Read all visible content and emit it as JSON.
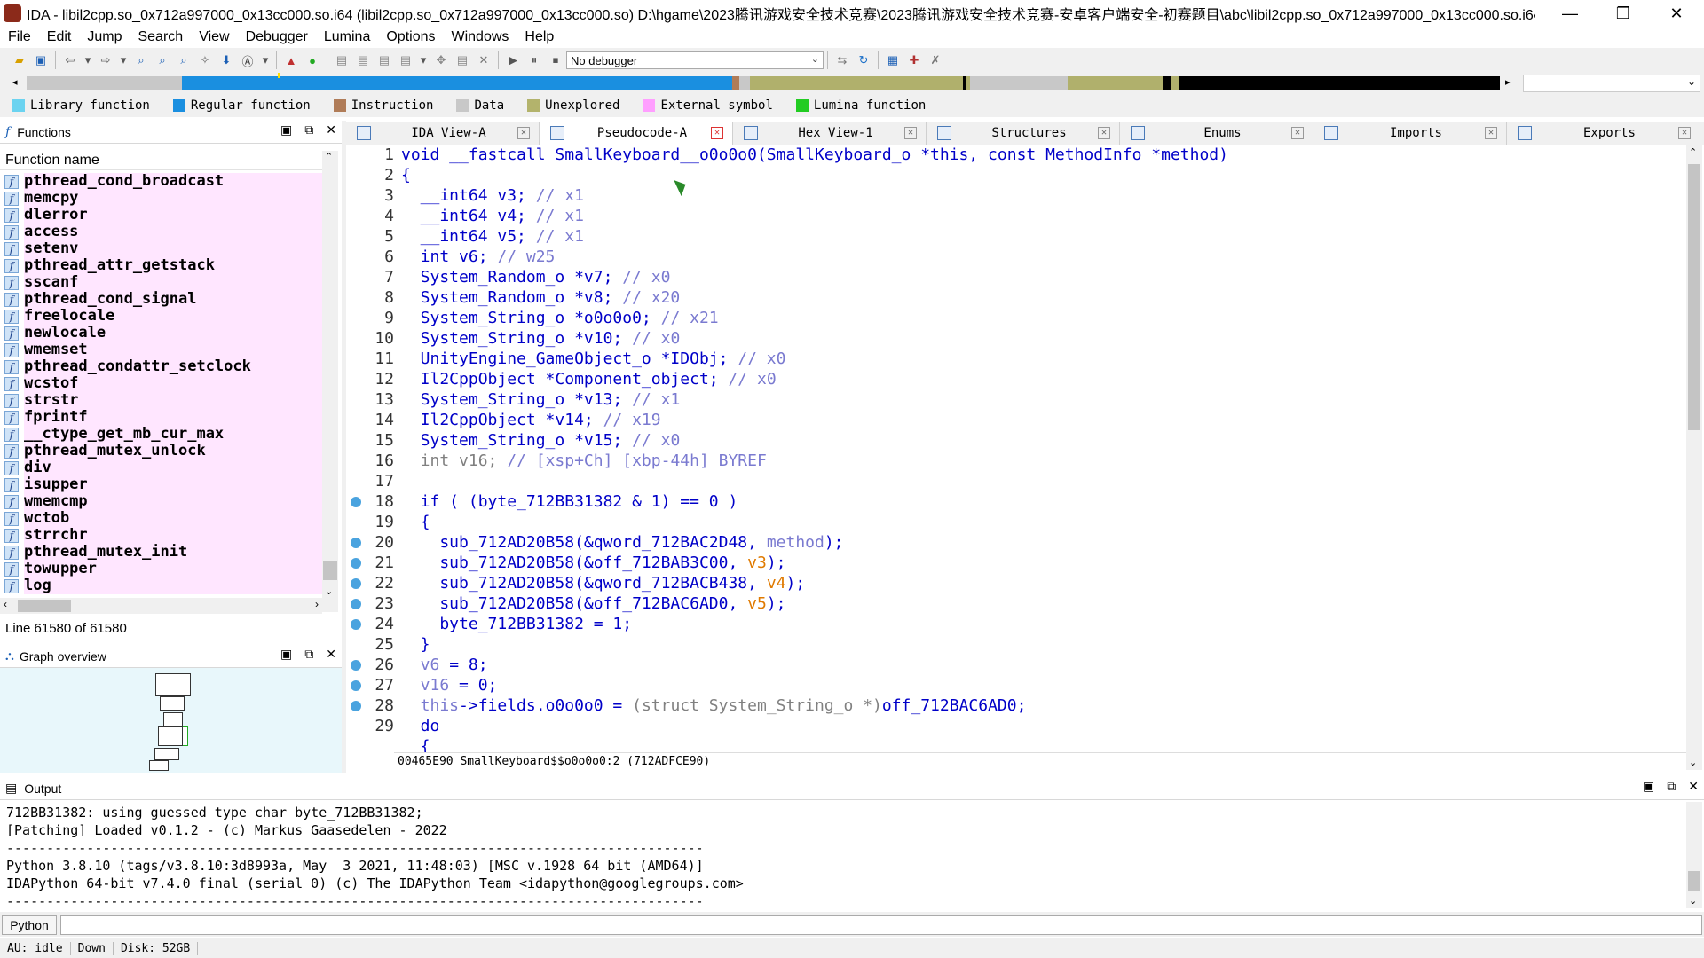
{
  "window": {
    "title": "IDA - libil2cpp.so_0x712a997000_0x13cc000.so.i64 (libil2cpp.so_0x712a997000_0x13cc000.so) D:\\hgame\\2023腾讯游戏安全技术竞赛\\2023腾讯游戏安全技术竞赛-安卓客户端安全-初赛题目\\abc\\libil2cpp.so_0x712a997000_0x13cc000.so.i64",
    "minimize": "—",
    "maximize": "❐",
    "close": "✕"
  },
  "menu": [
    "File",
    "Edit",
    "Jump",
    "Search",
    "View",
    "Debugger",
    "Lumina",
    "Options",
    "Windows",
    "Help"
  ],
  "toolbar": {
    "debugger_value": "No debugger"
  },
  "legend": [
    {
      "label": "Library function",
      "color": "#6bd3f0"
    },
    {
      "label": "Regular function",
      "color": "#1a8fe0"
    },
    {
      "label": "Instruction",
      "color": "#b07c58"
    },
    {
      "label": "Data",
      "color": "#c8c8c8"
    },
    {
      "label": "Unexplored",
      "color": "#b3b36c"
    },
    {
      "label": "External symbol",
      "color": "#ff9fff"
    },
    {
      "label": "Lumina function",
      "color": "#22cc22"
    }
  ],
  "functions_panel": {
    "title": "Functions",
    "column": "Function name",
    "items": [
      "pthread_cond_broadcast",
      "memcpy",
      "dlerror",
      "access",
      "setenv",
      "pthread_attr_getstack",
      "sscanf",
      "pthread_cond_signal",
      "freelocale",
      "newlocale",
      "wmemset",
      "pthread_condattr_setclock",
      "wcstof",
      "strstr",
      "fprintf",
      "__ctype_get_mb_cur_max",
      "pthread_mutex_unlock",
      "div",
      "isupper",
      "wmemcmp",
      "wctob",
      "strrchr",
      "pthread_mutex_init",
      "towupper",
      "log"
    ],
    "status": "Line 61580 of 61580"
  },
  "graph_panel": {
    "title": "Graph overview"
  },
  "tabs": [
    {
      "label": "IDA View-A",
      "active": false
    },
    {
      "label": "Pseudocode-A",
      "active": true
    },
    {
      "label": "Hex View-1",
      "active": false
    },
    {
      "label": "Structures",
      "active": false
    },
    {
      "label": "Enums",
      "active": false
    },
    {
      "label": "Imports",
      "active": false
    },
    {
      "label": "Exports",
      "active": false
    }
  ],
  "code": [
    {
      "n": "1",
      "bp": false,
      "parts": [
        [
          "t",
          "void __fastcall SmallKeyboard__o0o0o0(SmallKeyboard_o *this, const MethodInfo *method)"
        ]
      ]
    },
    {
      "n": "2",
      "bp": false,
      "parts": [
        [
          "t",
          "{"
        ]
      ]
    },
    {
      "n": "3",
      "bp": false,
      "parts": [
        [
          "t",
          "  __int64 v3; "
        ],
        [
          "m",
          "// x1"
        ]
      ]
    },
    {
      "n": "4",
      "bp": false,
      "parts": [
        [
          "t",
          "  __int64 v4; "
        ],
        [
          "m",
          "// x1"
        ]
      ]
    },
    {
      "n": "5",
      "bp": false,
      "parts": [
        [
          "t",
          "  __int64 v5; "
        ],
        [
          "m",
          "// x1"
        ]
      ]
    },
    {
      "n": "6",
      "bp": false,
      "parts": [
        [
          "t",
          "  int v6; "
        ],
        [
          "m",
          "// w25"
        ]
      ]
    },
    {
      "n": "7",
      "bp": false,
      "parts": [
        [
          "t",
          "  System_Random_o *v7; "
        ],
        [
          "m",
          "// x0"
        ]
      ]
    },
    {
      "n": "8",
      "bp": false,
      "parts": [
        [
          "t",
          "  System_Random_o *v8; "
        ],
        [
          "m",
          "// x20"
        ]
      ]
    },
    {
      "n": "9",
      "bp": false,
      "parts": [
        [
          "t",
          "  System_String_o *o0o0o0; "
        ],
        [
          "m",
          "// x21"
        ]
      ]
    },
    {
      "n": "10",
      "bp": false,
      "parts": [
        [
          "t",
          "  System_String_o *v10; "
        ],
        [
          "m",
          "// x0"
        ]
      ]
    },
    {
      "n": "11",
      "bp": false,
      "parts": [
        [
          "t",
          "  UnityEngine_GameObject_o *IDObj; "
        ],
        [
          "m",
          "// x0"
        ]
      ]
    },
    {
      "n": "12",
      "bp": false,
      "parts": [
        [
          "t",
          "  Il2CppObject *Component_object; "
        ],
        [
          "m",
          "// x0"
        ]
      ]
    },
    {
      "n": "13",
      "bp": false,
      "parts": [
        [
          "t",
          "  System_String_o *v13; "
        ],
        [
          "m",
          "// x1"
        ]
      ]
    },
    {
      "n": "14",
      "bp": false,
      "parts": [
        [
          "t",
          "  Il2CppObject *v14; "
        ],
        [
          "m",
          "// x19"
        ]
      ]
    },
    {
      "n": "15",
      "bp": false,
      "parts": [
        [
          "t",
          "  System_String_o *v15; "
        ],
        [
          "m",
          "// x0"
        ]
      ]
    },
    {
      "n": "16",
      "bp": false,
      "parts": [
        [
          "g",
          "  int v16; "
        ],
        [
          "m",
          "// [xsp+Ch] [xbp-44h] BYREF"
        ]
      ]
    },
    {
      "n": "17",
      "bp": false,
      "parts": [
        [
          "t",
          ""
        ]
      ]
    },
    {
      "n": "18",
      "bp": true,
      "parts": [
        [
          "t",
          "  if ( (byte_712BB31382 & 1) == 0 )"
        ]
      ]
    },
    {
      "n": "19",
      "bp": false,
      "parts": [
        [
          "t",
          "  {"
        ]
      ]
    },
    {
      "n": "20",
      "bp": true,
      "parts": [
        [
          "t",
          "    sub_712AD20B58(&qword_712BAC2D48, "
        ],
        [
          "m",
          "method"
        ],
        [
          "t",
          ");"
        ]
      ]
    },
    {
      "n": "21",
      "bp": true,
      "parts": [
        [
          "t",
          "    sub_712AD20B58(&off_712BAB3C00, "
        ],
        [
          "v",
          "v3"
        ],
        [
          "t",
          ");"
        ]
      ]
    },
    {
      "n": "22",
      "bp": true,
      "parts": [
        [
          "t",
          "    sub_712AD20B58(&qword_712BACB438, "
        ],
        [
          "v",
          "v4"
        ],
        [
          "t",
          ");"
        ]
      ]
    },
    {
      "n": "23",
      "bp": true,
      "parts": [
        [
          "t",
          "    sub_712AD20B58(&off_712BAC6AD0, "
        ],
        [
          "v",
          "v5"
        ],
        [
          "t",
          ");"
        ]
      ]
    },
    {
      "n": "24",
      "bp": true,
      "parts": [
        [
          "t",
          "    byte_712BB31382 = 1;"
        ]
      ]
    },
    {
      "n": "25",
      "bp": false,
      "parts": [
        [
          "t",
          "  }"
        ]
      ]
    },
    {
      "n": "26",
      "bp": true,
      "parts": [
        [
          "m",
          "  v6"
        ],
        [
          "t",
          " = 8;"
        ]
      ]
    },
    {
      "n": "27",
      "bp": true,
      "parts": [
        [
          "m",
          "  v16"
        ],
        [
          "t",
          " = 0;"
        ]
      ]
    },
    {
      "n": "28",
      "bp": true,
      "parts": [
        [
          "m",
          "  this"
        ],
        [
          "t",
          "->fields.o0o0o0 = "
        ],
        [
          "g",
          "(struct System_String_o *)"
        ],
        [
          "t",
          "off_712BAC6AD0;"
        ]
      ]
    },
    {
      "n": "29",
      "bp": false,
      "parts": [
        [
          "t",
          "  do"
        ]
      ]
    },
    {
      "n": "",
      "bp": false,
      "parts": [
        [
          "t",
          "  {"
        ]
      ]
    }
  ],
  "code_status": "00465E90 SmallKeyboard$$o0o0o0:2 (712ADFCE90)",
  "output": {
    "title": "Output",
    "lines": [
      "712BB31382: using guessed type char byte_712BB31382;",
      "[Patching] Loaded v0.1.2 - (c) Markus Gaasedelen - 2022",
      "---------------------------------------------------------------------------------------",
      "Python 3.8.10 (tags/v3.8.10:3d8993a, May  3 2021, 11:48:03) [MSC v.1928 64 bit (AMD64)]",
      "IDAPython 64-bit v7.4.0 final (serial 0) (c) The IDAPython Team <idapython@googlegroups.com>",
      "---------------------------------------------------------------------------------------"
    ],
    "lang_button": "Python"
  },
  "statusbar": {
    "au": "AU:  idle",
    "dir": "Down",
    "disk": "Disk: 52GB"
  }
}
